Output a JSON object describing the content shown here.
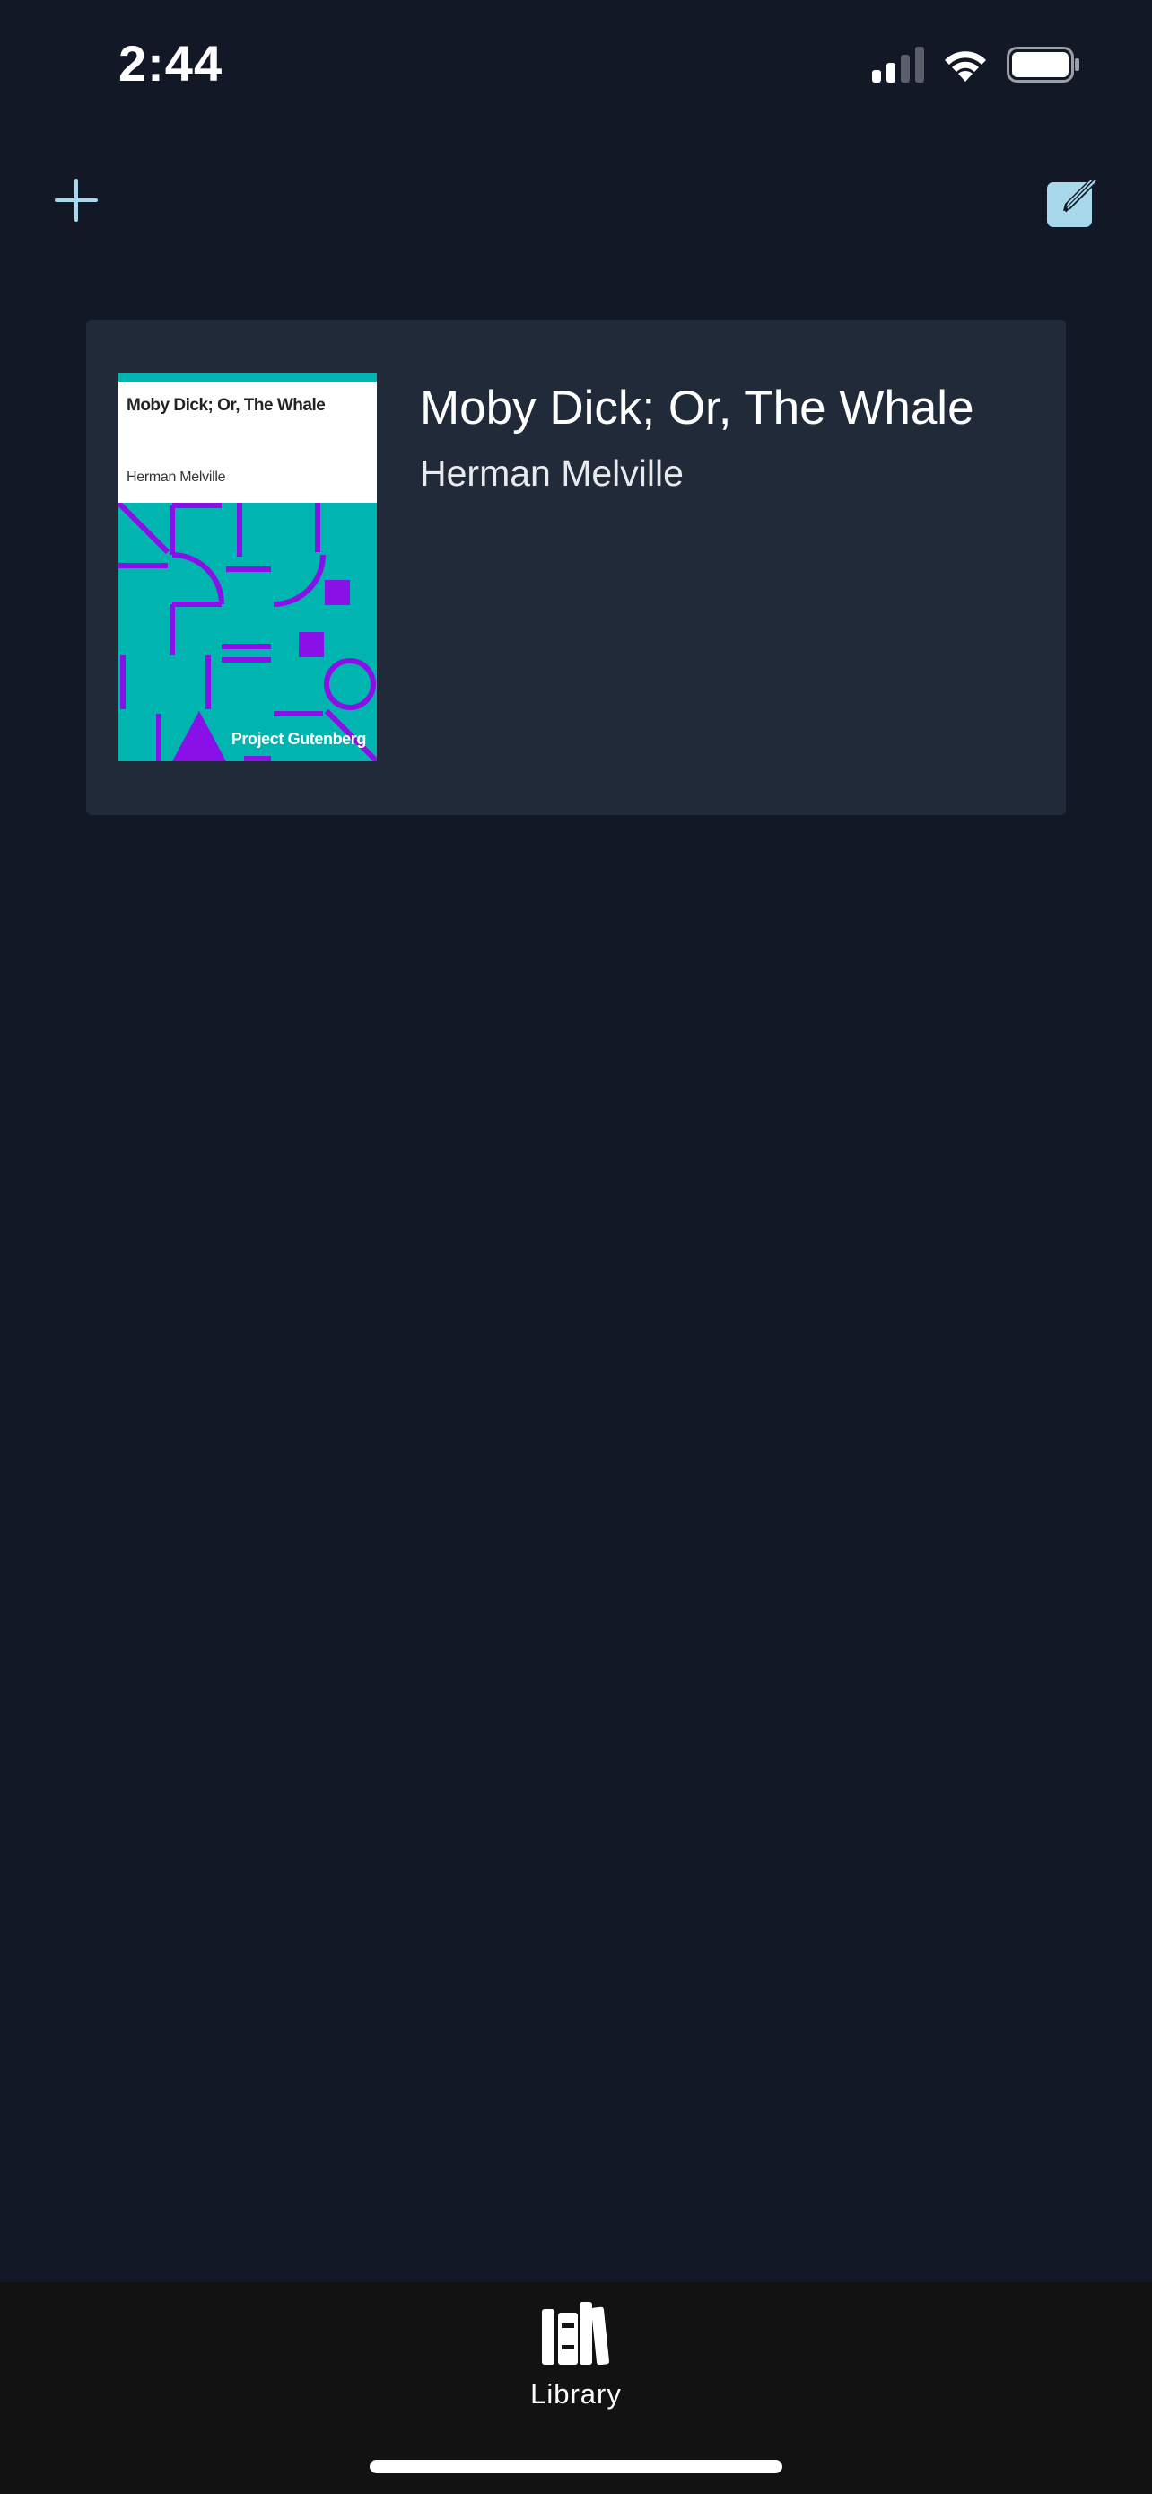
{
  "status_bar": {
    "time": "2:44",
    "icons": [
      "cellular-signal-icon",
      "wifi-icon",
      "battery-icon"
    ]
  },
  "toolbar": {
    "add_icon": "plus-icon",
    "edit_icon": "compose-icon",
    "accent_color": "#a8d8ec"
  },
  "library": {
    "books": [
      {
        "title": "Moby Dick; Or, The Whale",
        "author": "Herman Melville",
        "cover": {
          "title": "Moby Dick; Or, The Whale",
          "author": "Herman Melville",
          "publisher": "Project Gutenberg",
          "colors": {
            "band": "#00b4b0",
            "art_background": "#00b4b0",
            "art_shapes": "#8a10e8"
          }
        }
      }
    ]
  },
  "tab_bar": {
    "tabs": [
      {
        "label": "Library",
        "icon": "books-icon",
        "selected": true
      }
    ]
  },
  "colors": {
    "background": "#121826",
    "card": "#212a38",
    "tab_bar": "#121212"
  }
}
